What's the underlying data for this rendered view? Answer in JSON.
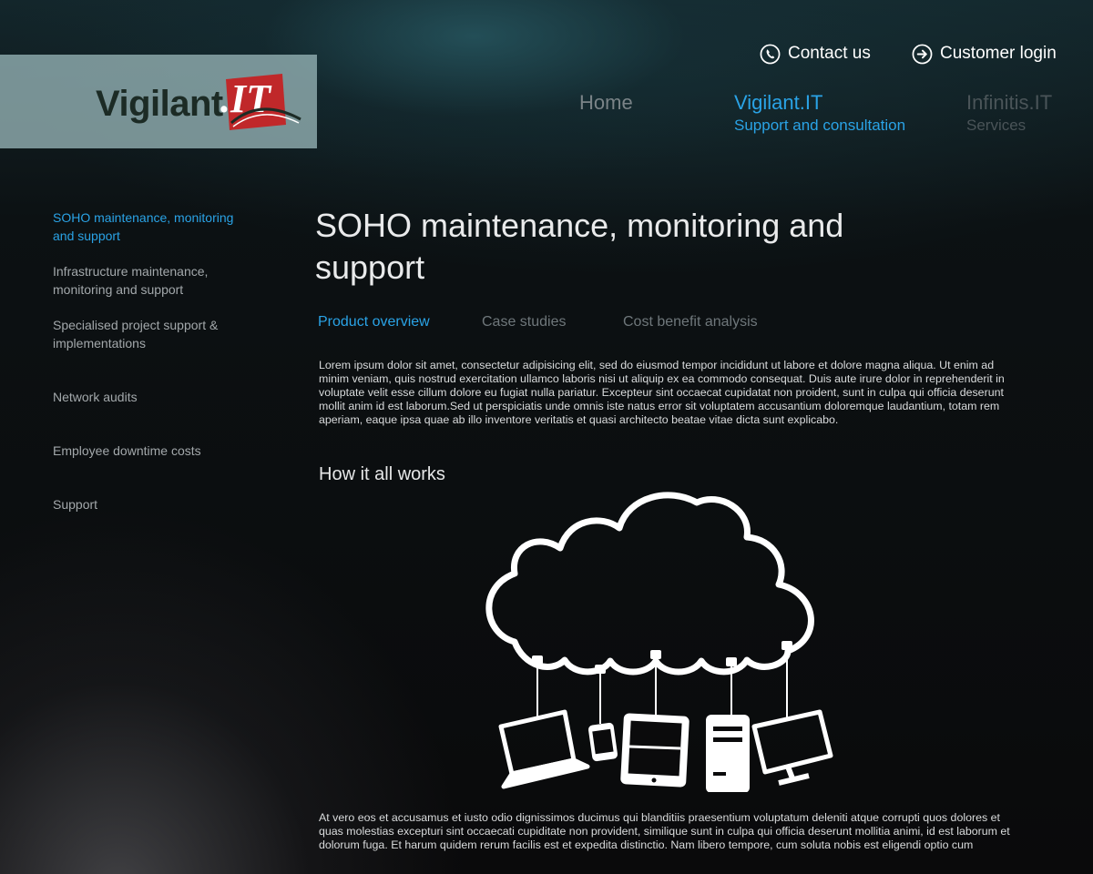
{
  "logo": {
    "text": "Vigilant",
    "mark_letters": ".IT",
    "mark_color": "#c0282a"
  },
  "top_links": {
    "contact": {
      "label": "Contact us",
      "icon": "phone-icon"
    },
    "login": {
      "label": "Customer login",
      "icon": "arrow-circle-right-icon"
    }
  },
  "nav": {
    "home": {
      "title": "Home"
    },
    "vigilant": {
      "title": "Vigilant.IT",
      "sub": "Support and consultation"
    },
    "infinitis": {
      "title": "Infinitis.IT",
      "sub": "Services"
    }
  },
  "sidebar": {
    "items": [
      {
        "label": "SOHO maintenance, monitoring and support",
        "active": true
      },
      {
        "label": "Infrastructure maintenance, monitoring and support"
      },
      {
        "label": "Specialised project support & implementations"
      },
      {
        "label": "Network audits"
      },
      {
        "label": "Employee downtime costs"
      },
      {
        "label": "Support"
      }
    ]
  },
  "main": {
    "title": "SOHO maintenance, monitoring and support",
    "tabs": [
      {
        "label": "Product overview",
        "active": true
      },
      {
        "label": "Case studies"
      },
      {
        "label": "Cost benefit analysis"
      }
    ],
    "intro": "Lorem ipsum dolor sit amet, consectetur adipisicing elit, sed do eiusmod tempor incididunt ut labore et dolore magna aliqua. Ut enim ad minim veniam, quis nostrud exercitation ullamco laboris nisi ut aliquip ex ea commodo consequat. Duis aute irure dolor in reprehenderit in voluptate velit esse cillum dolore eu fugiat nulla pariatur. Excepteur sint occaecat cupidatat non proident, sunt in culpa qui officia deserunt mollit anim id est laborum.Sed ut perspiciatis unde omnis iste natus error sit voluptatem accusantium doloremque laudantium, totam rem aperiam, eaque ipsa quae ab illo inventore veritatis et quasi architecto beatae vitae dicta sunt explicabo.",
    "section_heading": "How it all works",
    "diagram": "cloud-devices-diagram",
    "outro": "At vero eos et accusamus et iusto odio dignissimos ducimus qui blanditiis praesentium voluptatum deleniti atque corrupti quos dolores et quas molestias excepturi sint occaecati cupiditate non provident, similique sunt in culpa qui officia deserunt mollitia animi, id est laborum et dolorum fuga. Et harum quidem rerum facilis est et expedita distinctio. Nam libero tempore, cum soluta nobis est eligendi optio cum"
  },
  "colors": {
    "accent": "#2aa3e6",
    "text": "#e9eaeb",
    "muted": "#6f777b"
  }
}
